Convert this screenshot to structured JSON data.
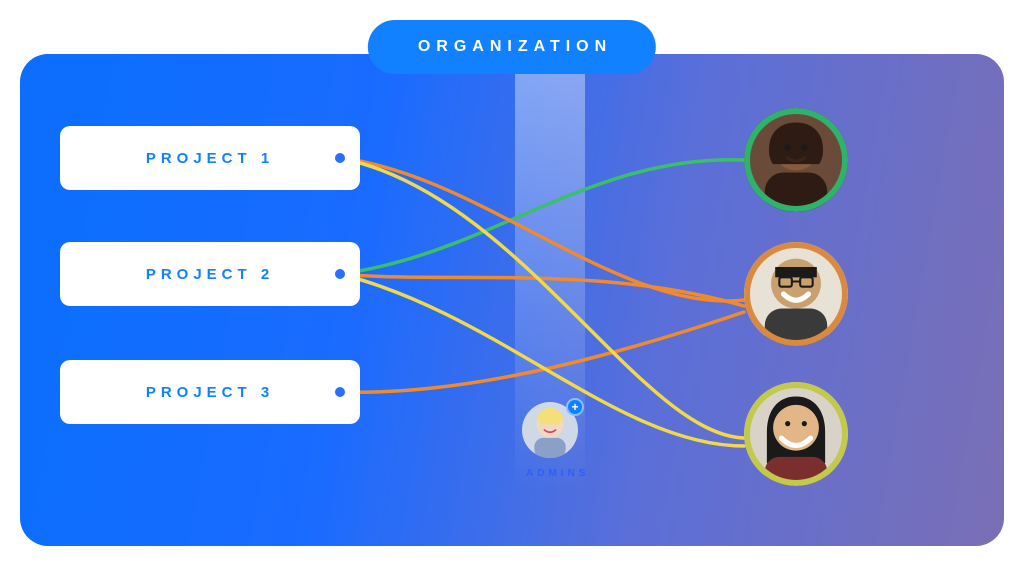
{
  "header": {
    "label": "ORGANIZATION"
  },
  "projects": [
    {
      "label": "PROJECT 1"
    },
    {
      "label": "PROJECT 2"
    },
    {
      "label": "PROJECT 3"
    }
  ],
  "users": [
    {
      "ring": "#2fb36a"
    },
    {
      "ring": "#d98a3f"
    },
    {
      "ring": "#c3c94a"
    }
  ],
  "admin": {
    "label": "ADMINS",
    "badge": "+"
  },
  "colors": {
    "green": "#3bbf6b",
    "orange": "#f08a2c",
    "yellow": "#f1d94a"
  },
  "connections": [
    {
      "from": 0,
      "to": 1,
      "color": "orange"
    },
    {
      "from": 0,
      "to": 2,
      "color": "yellow"
    },
    {
      "from": 1,
      "to": 0,
      "color": "green"
    },
    {
      "from": 1,
      "to": 1,
      "color": "orange"
    },
    {
      "from": 1,
      "to": 2,
      "color": "yellow"
    },
    {
      "from": 2,
      "to": 1,
      "color": "orange"
    }
  ]
}
